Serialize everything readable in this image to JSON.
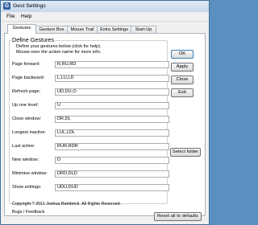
{
  "window": {
    "title": "Gest Settings",
    "icon_letter": "G"
  },
  "menu": [
    "File",
    "Help"
  ],
  "tabs": [
    "Gestures",
    "Gesture Box",
    "Mouse Trail",
    "Extra Settings",
    "Start-Up"
  ],
  "panel": {
    "group_title": "Define Gestures",
    "intro_line1": "Define your gestures below (click for help).",
    "intro_line2": "Mouse-over the action name for more info."
  },
  "gestures": [
    {
      "label": "Page forward:",
      "value": "R,RU,RD"
    },
    {
      "label": "Page backward:",
      "value": "L,LU,LD"
    },
    {
      "label": "Refresh page:",
      "value": "UD,DU,O"
    },
    {
      "label": "Up one level:",
      "value": "U"
    },
    {
      "label": "Close window:",
      "value": "DR,DL"
    },
    {
      "label": "Longest inactive:",
      "value": "LUL,LDL"
    },
    {
      "label": "Last active:",
      "value": "RUR,RDR"
    },
    {
      "label": "New window:",
      "value": "D"
    },
    {
      "label": "Minimise window:",
      "value": "DRD,DLD"
    },
    {
      "label": "Show settings:",
      "value": "UDU,DUD"
    }
  ],
  "buttons": {
    "ok": "OK",
    "apply": "Apply",
    "close": "Close",
    "exit": "Exit",
    "select_folder": "Select folder",
    "reset": "Reset all to defaults"
  },
  "footer": {
    "copyright": "Copyright ? 2011 Joshua Bambrick. All Rights Reserved.",
    "link": "Bugs / Feedback"
  }
}
